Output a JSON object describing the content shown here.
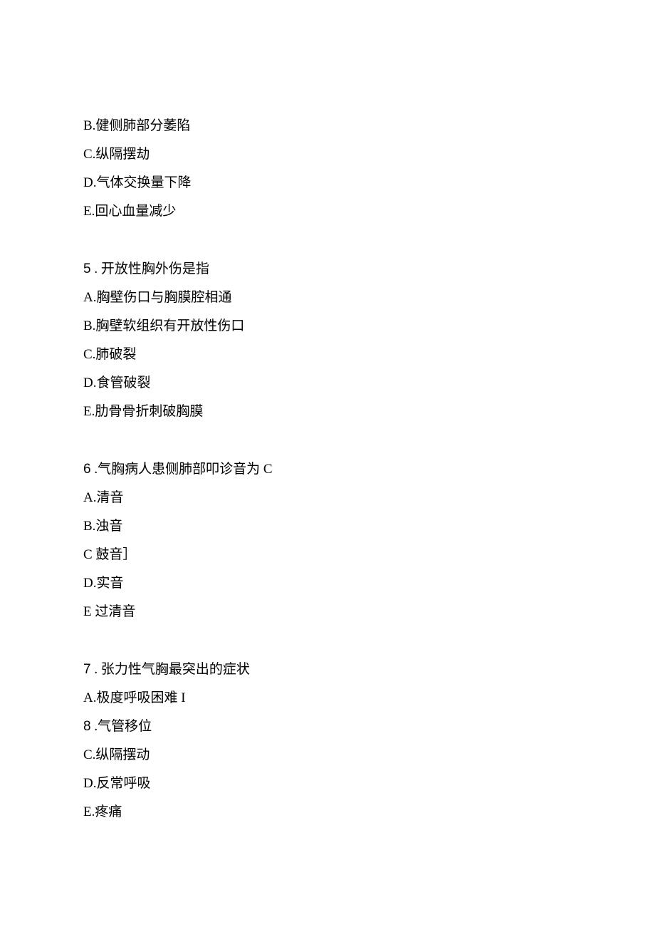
{
  "q4_partial": {
    "optB": "B.健侧肺部分萎陷",
    "optC": "C.纵隔摆劫",
    "optD": "D.气体交换量下降",
    "optE": "E.回心血量减少"
  },
  "q5": {
    "stem_prefix": "5",
    "stem_text": "  . 开放性胸外伤是指",
    "optA": "A.胸壁伤口与胸膜腔相通",
    "optB": "B.胸壁软组织有开放性伤口",
    "optC": "C.肺破裂",
    "optD": "D.食管破裂",
    "optE": "E.肋骨骨折刺破胸膜"
  },
  "q6": {
    "stem_prefix": "6",
    "stem_text": "   .气胸病人患侧肺部叩诊音为 C",
    "optA": "A.清音",
    "optB": "B.浊音",
    "optC": "C 鼓音］",
    "optD": "D.实音",
    "optE": "E 过清音"
  },
  "q7": {
    "stem_prefix": "7",
    "stem_text": "  . 张力性气胸最突出的症状",
    "optA": "A.极度呼吸困难 I",
    "optB_prefix": "8",
    "optB_text": "   .气管移位",
    "optC": "C.纵隔摆动",
    "optD": "D.反常呼吸",
    "optE": "E.疼痛"
  }
}
